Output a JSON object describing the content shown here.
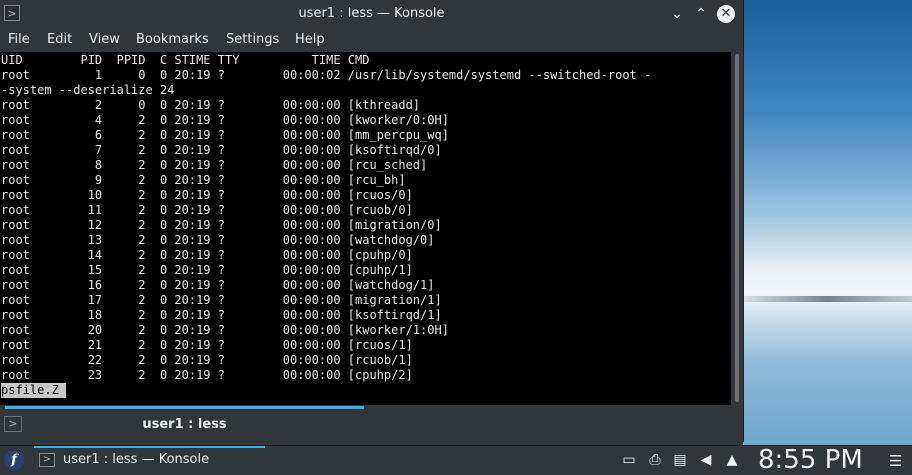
{
  "window": {
    "title": "user1 : less — Konsole",
    "app_icon": "terminal-icon",
    "controls": {
      "minimize": "⌄",
      "maximize": "⌃",
      "close": "✕"
    }
  },
  "menubar": {
    "items": [
      "File",
      "Edit",
      "View",
      "Bookmarks",
      "Settings",
      "Help"
    ]
  },
  "terminal": {
    "lines": [
      "UID        PID  PPID  C STIME TTY          TIME CMD",
      "root         1     0  0 20:19 ?        00:00:02 /usr/lib/systemd/systemd --switched-root -",
      "-system --deserialize 24",
      "root         2     0  0 20:19 ?        00:00:00 [kthreadd]",
      "root         4     2  0 20:19 ?        00:00:00 [kworker/0:0H]",
      "root         6     2  0 20:19 ?        00:00:00 [mm_percpu_wq]",
      "root         7     2  0 20:19 ?        00:00:00 [ksoftirqd/0]",
      "root         8     2  0 20:19 ?        00:00:00 [rcu_sched]",
      "root         9     2  0 20:19 ?        00:00:00 [rcu_bh]",
      "root        10     2  0 20:19 ?        00:00:00 [rcuos/0]",
      "root        11     2  0 20:19 ?        00:00:00 [rcuob/0]",
      "root        12     2  0 20:19 ?        00:00:00 [migration/0]",
      "root        13     2  0 20:19 ?        00:00:00 [watchdog/0]",
      "root        14     2  0 20:19 ?        00:00:00 [cpuhp/0]",
      "root        15     2  0 20:19 ?        00:00:00 [cpuhp/1]",
      "root        16     2  0 20:19 ?        00:00:00 [watchdog/1]",
      "root        17     2  0 20:19 ?        00:00:00 [migration/1]",
      "root        18     2  0 20:19 ?        00:00:00 [ksoftirqd/1]",
      "root        20     2  0 20:19 ?        00:00:00 [kworker/1:0H]",
      "root        21     2  0 20:19 ?        00:00:00 [rcuos/1]",
      "root        22     2  0 20:19 ?        00:00:00 [rcuob/1]",
      "root        23     2  0 20:19 ?        00:00:00 [cpuhp/2]"
    ],
    "status_prompt": "psfile.Z "
  },
  "tabbar": {
    "tab_label": "user1 : less",
    "new_tab_icon": "new-tab-icon"
  },
  "panel": {
    "launcher_label": "f",
    "task_label": "user1 : less — Konsole",
    "tray_icons": [
      "display-icon",
      "printer-icon",
      "clipboard-icon",
      "volume-icon",
      "expand-arrow-icon"
    ],
    "clock": "8:55 PM"
  },
  "colors": {
    "accent": "#3daee9",
    "chrome": "#31363b",
    "terminal_bg": "#000000",
    "terminal_fg": "#e8e8e8"
  }
}
